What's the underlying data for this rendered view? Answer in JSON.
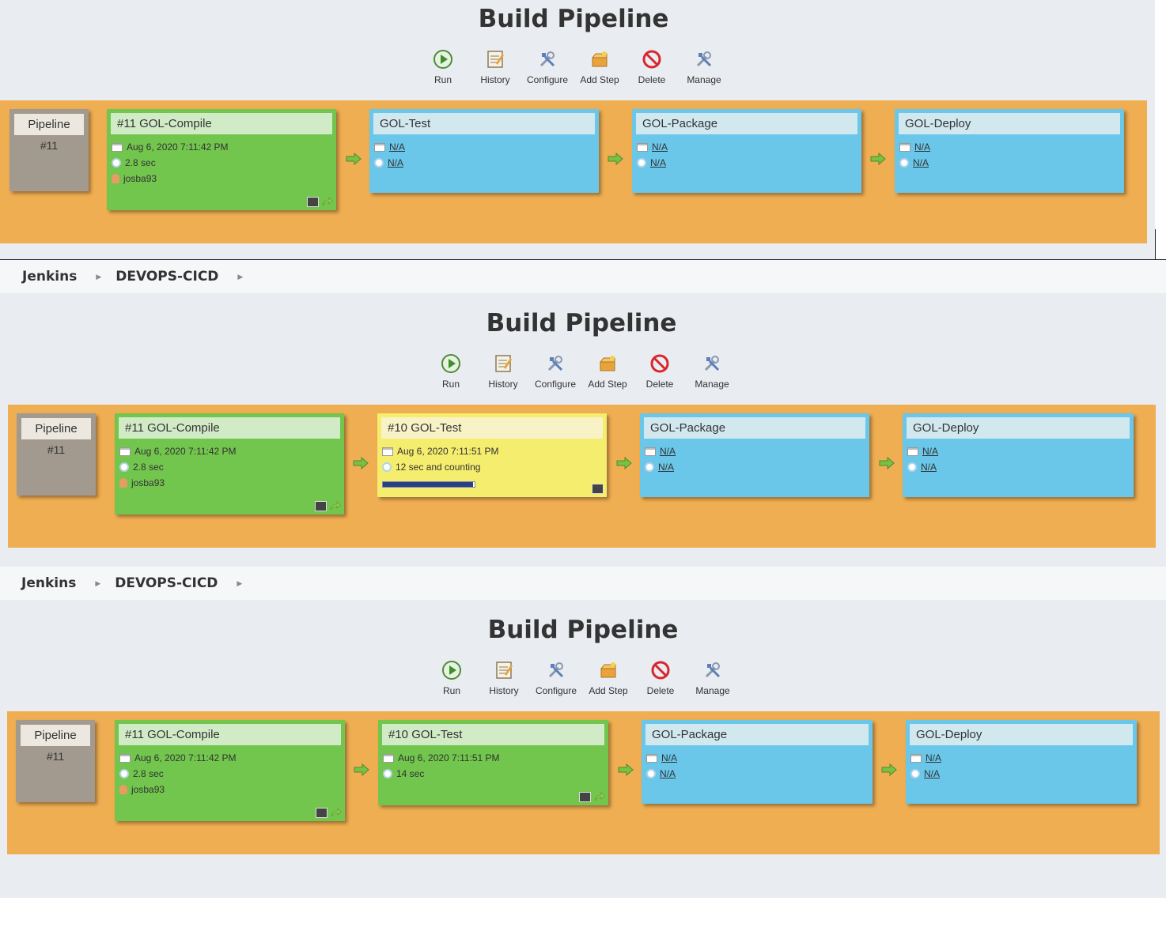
{
  "colors": {
    "page_bg": "#e9ecf1",
    "band": "#f0ae52",
    "success": "#72c54d",
    "pending": "#6ac7ea",
    "running": "#f5ed6d",
    "revision_box": "#a29a8f"
  },
  "breadcrumb": {
    "items": [
      "Jenkins",
      "DEVOPS-CICD"
    ]
  },
  "title": "Build Pipeline",
  "toolbar": {
    "run": "Run",
    "history": "History",
    "configure": "Configure",
    "add_step": "Add Step",
    "delete": "Delete",
    "manage": "Manage"
  },
  "revision": {
    "label": "Pipeline",
    "number": "#11"
  },
  "snapshots": [
    {
      "stages": [
        {
          "status": "success",
          "title": "#11 GOL-Compile",
          "date": "Aug 6, 2020 7:11:42 PM",
          "duration": "2.8 sec",
          "user": "josba93"
        },
        {
          "status": "pending",
          "title": "GOL-Test",
          "date": "N/A",
          "duration": "N/A"
        },
        {
          "status": "pending",
          "title": "GOL-Package",
          "date": "N/A",
          "duration": "N/A"
        },
        {
          "status": "pending",
          "title": "GOL-Deploy",
          "date": "N/A",
          "duration": "N/A"
        }
      ]
    },
    {
      "stages": [
        {
          "status": "success",
          "title": "#11 GOL-Compile",
          "date": "Aug 6, 2020 7:11:42 PM",
          "duration": "2.8 sec",
          "user": "josba93"
        },
        {
          "status": "running",
          "title": "#10 GOL-Test",
          "date": "Aug 6, 2020 7:11:51 PM",
          "duration": "12 sec and counting",
          "progress": 0.98
        },
        {
          "status": "pending",
          "title": "GOL-Package",
          "date": "N/A",
          "duration": "N/A"
        },
        {
          "status": "pending",
          "title": "GOL-Deploy",
          "date": "N/A",
          "duration": "N/A"
        }
      ]
    },
    {
      "stages": [
        {
          "status": "success",
          "title": "#11 GOL-Compile",
          "date": "Aug 6, 2020 7:11:42 PM",
          "duration": "2.8 sec",
          "user": "josba93"
        },
        {
          "status": "success",
          "title": "#10 GOL-Test",
          "date": "Aug 6, 2020 7:11:51 PM",
          "duration": "14 sec"
        },
        {
          "status": "pending",
          "title": "GOL-Package",
          "date": "N/A",
          "duration": "N/A"
        },
        {
          "status": "pending",
          "title": "GOL-Deploy",
          "date": "N/A",
          "duration": "N/A"
        }
      ]
    }
  ]
}
